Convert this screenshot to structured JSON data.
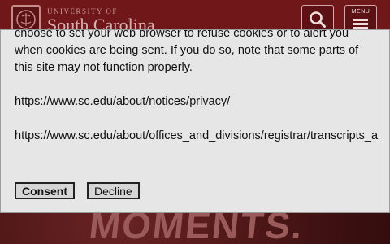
{
  "header": {
    "logo_top": "UNIVERSITY OF",
    "logo_main": "South Carolina",
    "search_icon": "search-icon",
    "menu_label": "MENU",
    "menu_icon": "hamburger-icon"
  },
  "hero": {
    "text": "MOMENTS."
  },
  "cookie_dialog": {
    "paragraph": "choose to set your web browser to refuse cookies or to alert you when cookies are being sent. If you do so, note that some parts of this site may not function properly.",
    "link_privacy": "https://www.sc.edu/about/notices/privacy/",
    "link_registrar": "https://www.sc.edu/about/offices_and_divisions/registrar/transcripts_a",
    "consent_label": "Consent",
    "decline_label": "Decline"
  },
  "colors": {
    "brand": "#73000a",
    "dialog_bg": "#e6e6e6"
  }
}
